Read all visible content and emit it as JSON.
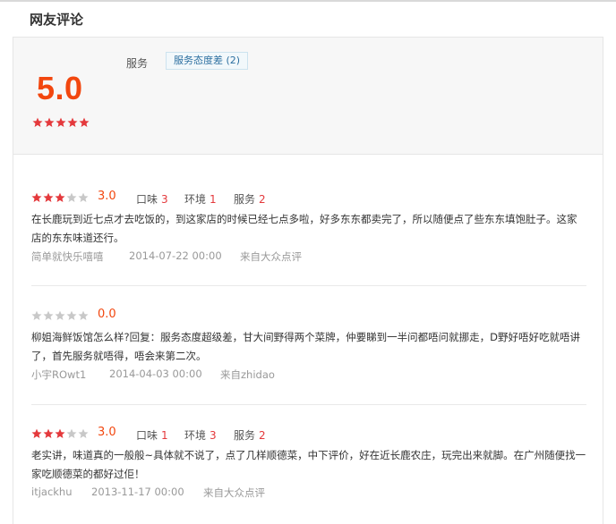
{
  "section_title": "网友评论",
  "summary": {
    "score": "5.0",
    "stars": 5,
    "tag_label": "服务",
    "tag_chip": "服务态度差 (2)"
  },
  "colors": {
    "accent": "#f2470f",
    "star_on": "#e4393c",
    "star_off": "#c8c8c8"
  },
  "reviews": [
    {
      "stars": 3,
      "rating": "3.0",
      "taste_label": "口味",
      "taste": "3",
      "env_label": "环境",
      "env": "1",
      "service_label": "服务",
      "service": "2",
      "content": "在长鹿玩到近七点才去吃饭的，到这家店的时候已经七点多啦，好多东东都卖完了，所以随便点了些东东填饱肚子。这家店的东东味道还行。",
      "user": "简单就快乐嘻嘻",
      "date": "2014-07-22 00:00",
      "source": "来自大众点评"
    },
    {
      "stars": 0,
      "rating": "0.0",
      "content": "柳姐海鲜饭馆怎么样?回复：服务态度超级差，甘大间野得两个菜牌，仲要睇到一半问都唔问就挪走，D野好唔好吃就唔讲了，首先服务就唔得，唔会来第二次。",
      "user": "小宇ROwt1",
      "date": "2014-04-03 00:00",
      "source": "来自zhidao"
    },
    {
      "stars": 3,
      "rating": "3.0",
      "taste_label": "口味",
      "taste": "1",
      "env_label": "环境",
      "env": "3",
      "service_label": "服务",
      "service": "2",
      "content": "老实讲，味道真的一般般~具体就不说了，点了几样顺德菜，中下评价，好在近长鹿农庄，玩完出来就脚。在广州随便找一家吃顺德菜的都好过佢！",
      "user": "itjackhu",
      "date": "2013-11-17 00:00",
      "source": "来自大众点评"
    }
  ]
}
